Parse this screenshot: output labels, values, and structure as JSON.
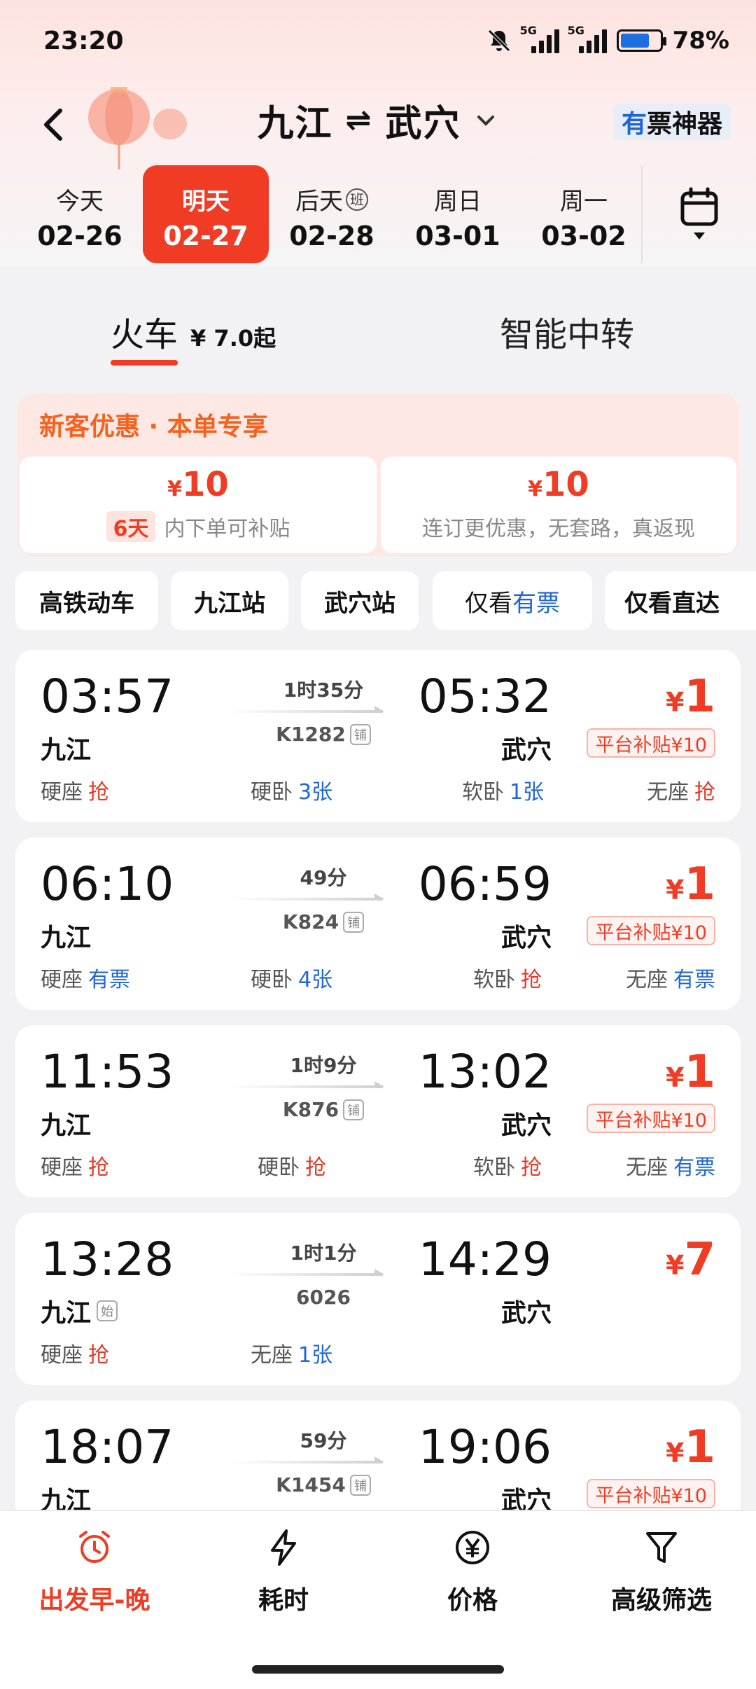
{
  "status_bar": {
    "time": "23:20",
    "network1": "5G",
    "network2": "5G",
    "battery": "78%",
    "battery_level": 0.78
  },
  "header": {
    "from": "九江",
    "swap": "⇌",
    "to": "武穴",
    "magic_prefix": "有",
    "magic_suffix": "票神器"
  },
  "dates": [
    {
      "day": "今天",
      "date": "02-26",
      "badge": ""
    },
    {
      "day": "明天",
      "date": "02-27",
      "badge": "",
      "active": true
    },
    {
      "day": "后天",
      "date": "02-28",
      "badge": "班"
    },
    {
      "day": "周日",
      "date": "03-01",
      "badge": ""
    },
    {
      "day": "周一",
      "date": "03-02",
      "badge": ""
    }
  ],
  "tabs": {
    "train": "火车",
    "train_price": "¥ 7.0起",
    "transfer": "智能中转"
  },
  "promo": {
    "title": "新客优惠 · 本单专享",
    "coupon1": {
      "symbol": "¥",
      "amount": "10",
      "days": "6天",
      "desc": "内下单可补贴"
    },
    "coupon2": {
      "symbol": "¥",
      "amount": "10",
      "desc": "连订更优惠，无套路，真返现"
    }
  },
  "filters": {
    "f1": "高铁动车",
    "f2": "九江站",
    "f3": "武穴站",
    "f4_a": "仅看",
    "f4_b": "有票",
    "f5": "仅看直达"
  },
  "trains": [
    {
      "dep": "03:57",
      "arr": "05:32",
      "from": "九江",
      "to": "武穴",
      "duration": "1时35分",
      "no": "K1282",
      "tag": "铺",
      "price_symbol": "¥",
      "price": "1",
      "subsidy": "平台补贴¥10",
      "s1_name": "硬座",
      "s1_val": "抢",
      "s2_name": "硬卧",
      "s2_val": "3张",
      "s3_name": "软卧",
      "s3_val": "1张",
      "s4_name": "无座",
      "s4_val": "抢"
    },
    {
      "dep": "06:10",
      "arr": "06:59",
      "from": "九江",
      "to": "武穴",
      "duration": "49分",
      "no": "K824",
      "tag": "铺",
      "price_symbol": "¥",
      "price": "1",
      "subsidy": "平台补贴¥10",
      "s1_name": "硬座",
      "s1_val": "有票",
      "s2_name": "硬卧",
      "s2_val": "4张",
      "s3_name": "软卧",
      "s3_val": "抢",
      "s4_name": "无座",
      "s4_val": "有票"
    },
    {
      "dep": "11:53",
      "arr": "13:02",
      "from": "九江",
      "to": "武穴",
      "duration": "1时9分",
      "no": "K876",
      "tag": "铺",
      "price_symbol": "¥",
      "price": "1",
      "subsidy": "平台补贴¥10",
      "s1_name": "硬座",
      "s1_val": "抢",
      "s2_name": "硬卧",
      "s2_val": "抢",
      "s3_name": "软卧",
      "s3_val": "抢",
      "s4_name": "无座",
      "s4_val": "有票"
    },
    {
      "dep": "13:28",
      "arr": "14:29",
      "from": "九江",
      "from_tag": "始",
      "to": "武穴",
      "duration": "1时1分",
      "no": "6026",
      "price_symbol": "¥",
      "price": "7",
      "s1_name": "硬座",
      "s1_val": "抢",
      "s2_name": "无座",
      "s2_val": "1张"
    },
    {
      "dep": "18:07",
      "arr": "19:06",
      "from": "九江",
      "to": "武穴",
      "duration": "59分",
      "no": "K1454",
      "tag": "铺",
      "price_symbol": "¥",
      "price": "1",
      "subsidy": "平台补贴¥10"
    }
  ],
  "bottom_nav": {
    "b1": "出发早-晚",
    "b2": "耗时",
    "b3": "价格",
    "b4": "高级筛选"
  },
  "colors": {
    "accent": "#f03c24",
    "link": "#1f66d6",
    "promo_orange": "#f5621e"
  }
}
